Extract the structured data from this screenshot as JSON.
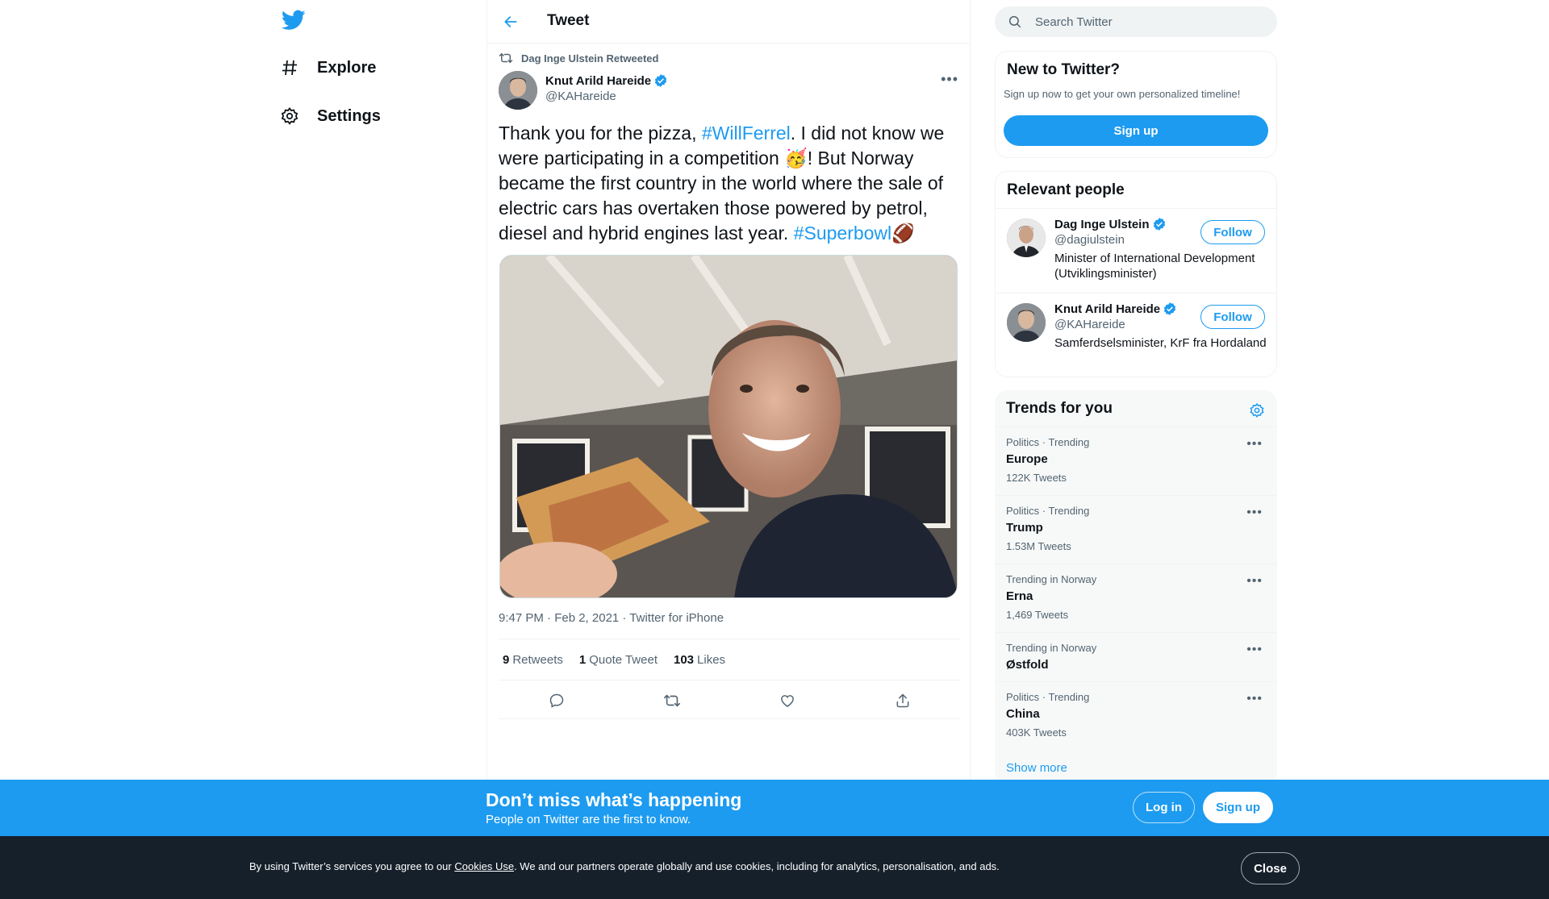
{
  "nav": {
    "explore_label": "Explore",
    "settings_label": "Settings"
  },
  "header": {
    "title": "Tweet"
  },
  "tweet": {
    "retweeted_by": "Dag Inge Ulstein Retweeted",
    "author_name": "Knut Arild Hareide",
    "author_handle": "@KAHareide",
    "text_part1": "Thank you for the pizza, ",
    "hashtag1": "#WillFerrel",
    "text_part2": ". I did not know we were participating in a competition ",
    "emoji1": "🥳",
    "text_part3": "! But Norway became the first country in the world where the sale of electric cars has overtaken those powered by petrol, diesel and hybrid engines last year. ",
    "hashtag2": "#Superbowl",
    "emoji2": "🏈",
    "timestamp": "9:47 PM · Feb 2, 2021 · Twitter for iPhone",
    "retweets_count": "9",
    "retweets_label": "Retweets",
    "quotes_count": "1",
    "quotes_label": "Quote Tweet",
    "likes_count": "103",
    "likes_label": "Likes"
  },
  "search": {
    "placeholder": "Search Twitter"
  },
  "new_to_twitter": {
    "title": "New to Twitter?",
    "subtitle": "Sign up now to get your own personalized timeline!",
    "signup_label": "Sign up"
  },
  "relevant_people": {
    "title": "Relevant people",
    "people": [
      {
        "name": "Dag Inge Ulstein",
        "handle": "@dagiulstein",
        "bio": "Minister of International Development (Utviklingsminister)",
        "follow_label": "Follow"
      },
      {
        "name": "Knut Arild Hareide",
        "handle": "@KAHareide",
        "bio": "Samferdselsminister, KrF fra Hordaland",
        "follow_label": "Follow"
      }
    ]
  },
  "trends": {
    "title": "Trends for you",
    "items": [
      {
        "meta": "Politics · Trending",
        "name": "Europe",
        "count": "122K Tweets"
      },
      {
        "meta": "Politics · Trending",
        "name": "Trump",
        "count": "1.53M Tweets"
      },
      {
        "meta": "Trending in Norway",
        "name": "Erna",
        "count": "1,469 Tweets"
      },
      {
        "meta": "Trending in Norway",
        "name": "Østfold",
        "count": ""
      },
      {
        "meta": "Politics · Trending",
        "name": "China",
        "count": "403K Tweets"
      }
    ],
    "show_more": "Show more"
  },
  "promo": {
    "title": "Don’t miss what’s happening",
    "subtitle": "People on Twitter are the first to know.",
    "login_label": "Log in",
    "signup_label": "Sign up"
  },
  "cookie": {
    "text_before": "By using Twitter’s services you agree to our ",
    "link_label": "Cookies Use",
    "text_after": ". We and our partners operate globally and use cookies, including for analytics, personalisation, and ads.",
    "close_label": "Close"
  },
  "colors": {
    "accent": "#1d9bf0",
    "text": "#0f1419",
    "secondary": "#536471",
    "cookie_bg": "#15202b"
  },
  "icons": [
    "twitter-logo-icon",
    "hashtag-icon",
    "gear-icon",
    "back-arrow-icon",
    "retweet-icon",
    "verified-badge-icon",
    "more-icon",
    "reply-icon",
    "like-icon",
    "share-icon",
    "search-icon"
  ]
}
